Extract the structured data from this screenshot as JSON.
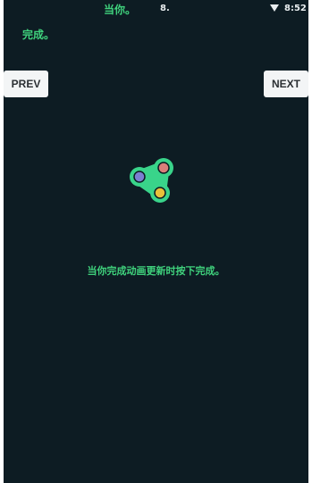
{
  "status_bar": {
    "center_text": "当你。",
    "signal_text": "8.",
    "time": "8:52",
    "wifi_icon": "wifi-icon"
  },
  "top_text": "完成。",
  "nav": {
    "prev_label": "PREV",
    "next_label": "NEXT"
  },
  "spinner": {
    "icon": "fidget-spinner-icon",
    "body_color": "#39d48a",
    "dot_colors": [
      "#7b7fd1",
      "#d97f7a",
      "#e8c13a"
    ]
  },
  "instruction": "当你完成动画更新时按下完成。",
  "colors": {
    "background": "#0d1c23",
    "accent_green": "#3fd17c",
    "button_bg": "#f3f5f6"
  }
}
